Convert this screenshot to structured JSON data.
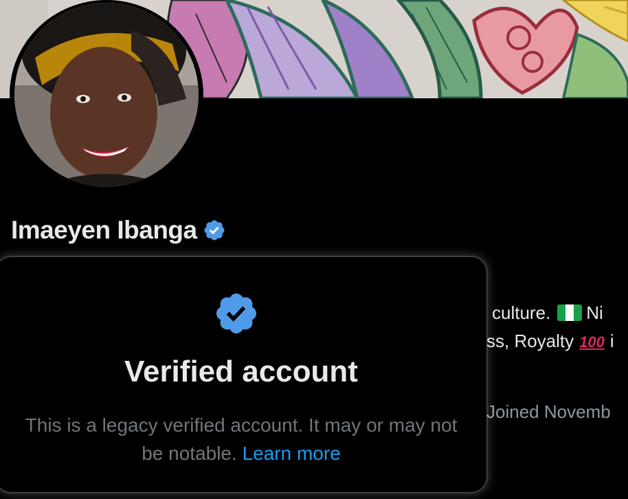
{
  "profile": {
    "display_name": "Imaeyen Ibanga",
    "verified_icon": "verified-badge-icon",
    "bio_line_1": "culture.",
    "bio_line_1_suffix": "Ni",
    "bio_line_2": "ss, Royalty",
    "bio_line_2_suffix": "i",
    "hundred_emoji": "100",
    "joined_text": "Joined Novemb"
  },
  "popover": {
    "icon": "verified-badge-icon",
    "title": "Verified account",
    "description": "This is a legacy verified account. It may or may not be notable.",
    "learn_more_label": "Learn more"
  },
  "colors": {
    "accent": "#1d9bf0",
    "badge": "#4f9bea",
    "text_primary": "#e7e9ea",
    "text_secondary": "#71767b",
    "background": "#000000"
  }
}
